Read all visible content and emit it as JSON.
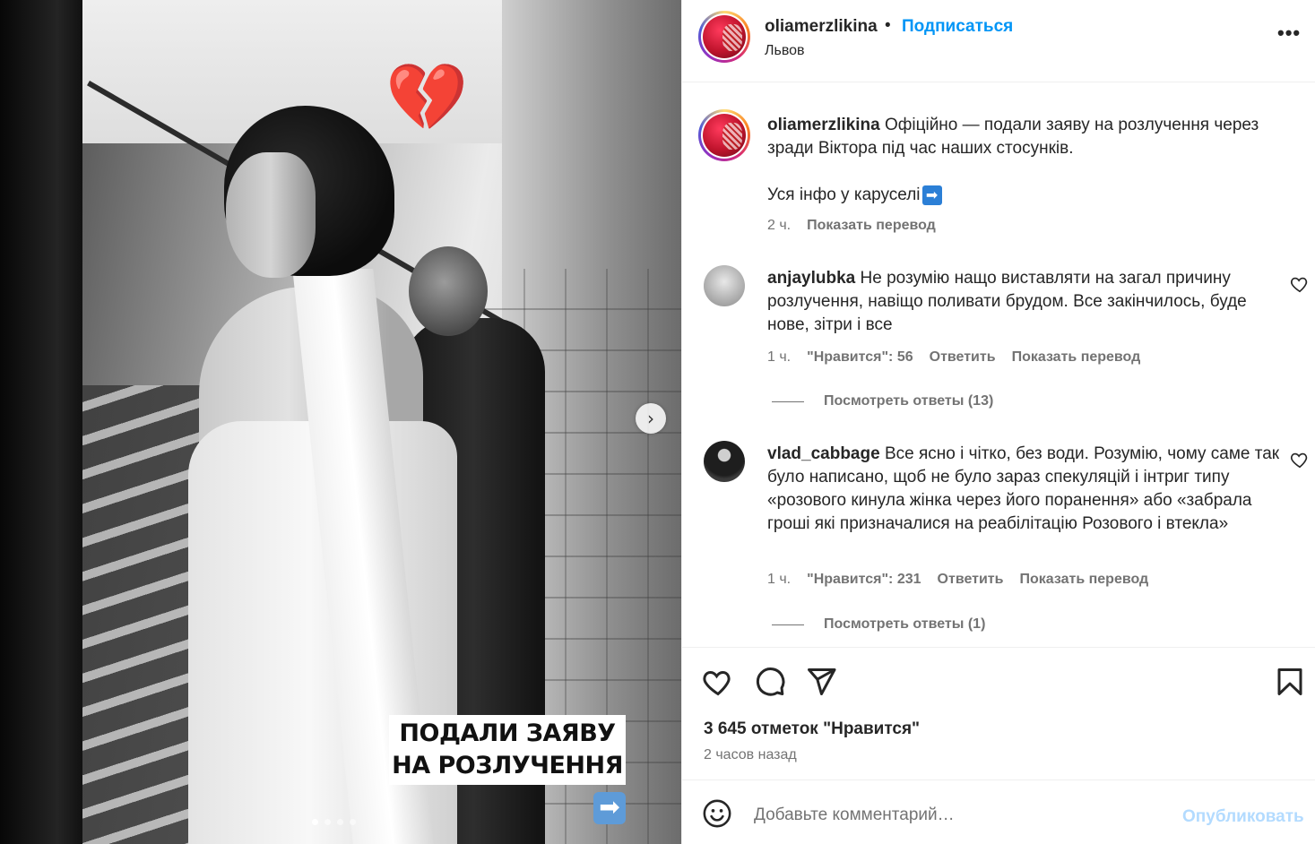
{
  "photo": {
    "emoji": "💔",
    "caption_line1": "ПОДАЛИ ЗАЯВУ",
    "caption_line2": "НА РОЗЛУЧЕННЯ",
    "caption_arrow": "➡",
    "next_icon": "›",
    "carousel_count": 4,
    "carousel_active": 1
  },
  "header": {
    "username": "oliamerzlikina",
    "separator": "•",
    "follow_label": "Подписаться",
    "location": "Львов",
    "more_label": "•••"
  },
  "post": {
    "username": "oliamerzlikina",
    "text_line1": "Офіційно — подали заяву на розлучення через зради Віктора під час наших стосунків.",
    "text_line2": "Уся інфо у каруселі",
    "text_emoji": "➡",
    "time": "2 ч.",
    "translate_label": "Показать перевод"
  },
  "comments": [
    {
      "username": "anjaylubka",
      "text": "Не розумію нащо виставляти на загал причину розлучення, навіщо поливати брудом. Все закінчилось, буде нове, зітри і все",
      "time": "1 ч.",
      "likes": "\"Нравится\": 56",
      "reply_label": "Ответить",
      "translate_label": "Показать перевод",
      "view_replies": "Посмотреть ответы (13)"
    },
    {
      "username": "vlad_cabbage",
      "text": "Все ясно і чітко, без води. Розумію, чому саме так було написано, щоб не було зараз спекуляцій і інтриг типу «розового кинула жінка через його поранення» або «забрала гроші які призначалися на реабілітацію Розового і втекла»",
      "time": "1 ч.",
      "likes": "\"Нравится\": 231",
      "reply_label": "Ответить",
      "translate_label": "Показать перевод",
      "view_replies": "Посмотреть ответы (1)"
    }
  ],
  "actions": {
    "icons": [
      "heart-icon",
      "comment-icon",
      "share-icon",
      "bookmark-icon"
    ],
    "likes_count": "3 645 отметок \"Нравится\"",
    "time_ago": "2 часов назад"
  },
  "add_comment": {
    "placeholder": "Добавьте комментарий…",
    "post_label": "Опубликовать"
  },
  "colors": {
    "link_blue": "#0095f6",
    "post_disabled": "#b3dbff",
    "muted": "#737373",
    "text": "#262626"
  }
}
